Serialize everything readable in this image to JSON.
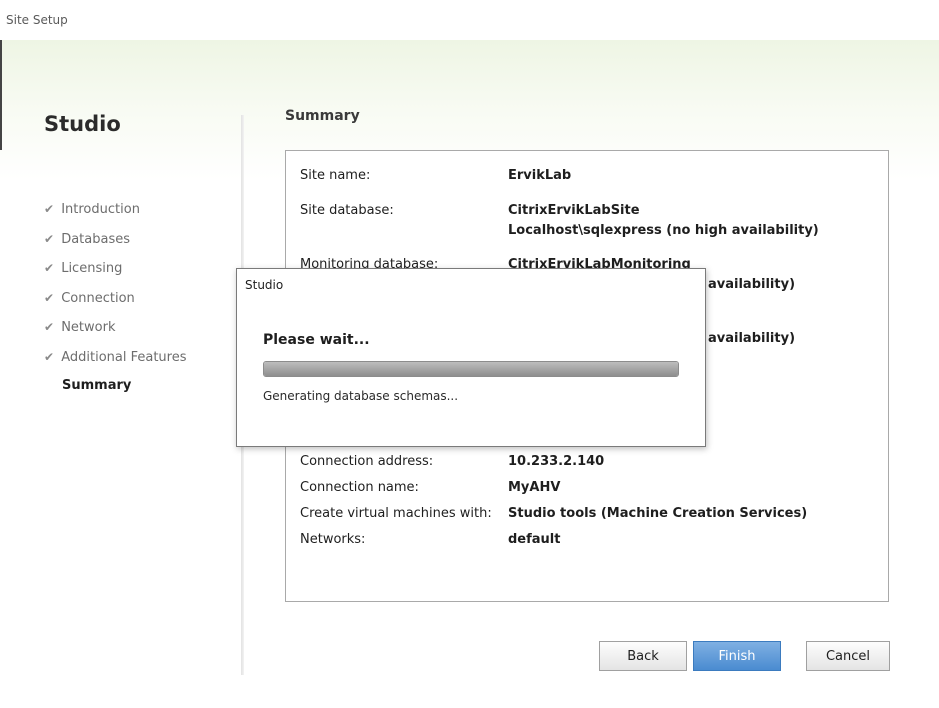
{
  "window": {
    "title": "Site Setup"
  },
  "sidebar": {
    "heading": "Studio",
    "items": [
      {
        "label": "Introduction",
        "done": true
      },
      {
        "label": "Databases",
        "done": true
      },
      {
        "label": "Licensing",
        "done": true
      },
      {
        "label": "Connection",
        "done": true
      },
      {
        "label": "Network",
        "done": true
      },
      {
        "label": "Additional Features",
        "done": true
      },
      {
        "label": "Summary",
        "done": false,
        "current": true
      }
    ],
    "check_glyph": "✔"
  },
  "summary": {
    "heading": "Summary",
    "rows": [
      {
        "label": "Site name:",
        "values": [
          "ErvikLab"
        ]
      },
      {
        "label": "Site database:",
        "values": [
          "CitrixErvikLabSite",
          "Localhost\\sqlexpress (no high availability)"
        ]
      },
      {
        "label": "Monitoring database:",
        "values": [
          "CitrixErvikLabMonitoring",
          "availability)"
        ]
      },
      {
        "label": "",
        "values": [
          "availability)"
        ]
      },
      {
        "label": "Connection address:",
        "values": [
          "10.233.2.140"
        ]
      },
      {
        "label": "Connection name:",
        "values": [
          "MyAHV"
        ]
      },
      {
        "label": "Create virtual machines with:",
        "values": [
          "Studio tools (Machine Creation Services)"
        ]
      },
      {
        "label": "Networks:",
        "values": [
          "default"
        ]
      }
    ]
  },
  "buttons": {
    "back": "Back",
    "finish": "Finish",
    "cancel": "Cancel"
  },
  "dialog": {
    "title": "Studio",
    "heading": "Please wait...",
    "status": "Generating database schemas...",
    "progress_fraction": 1.0
  },
  "colors": {
    "accent_button": "#4a8bd0",
    "header_gradient": "#eef5e4"
  }
}
